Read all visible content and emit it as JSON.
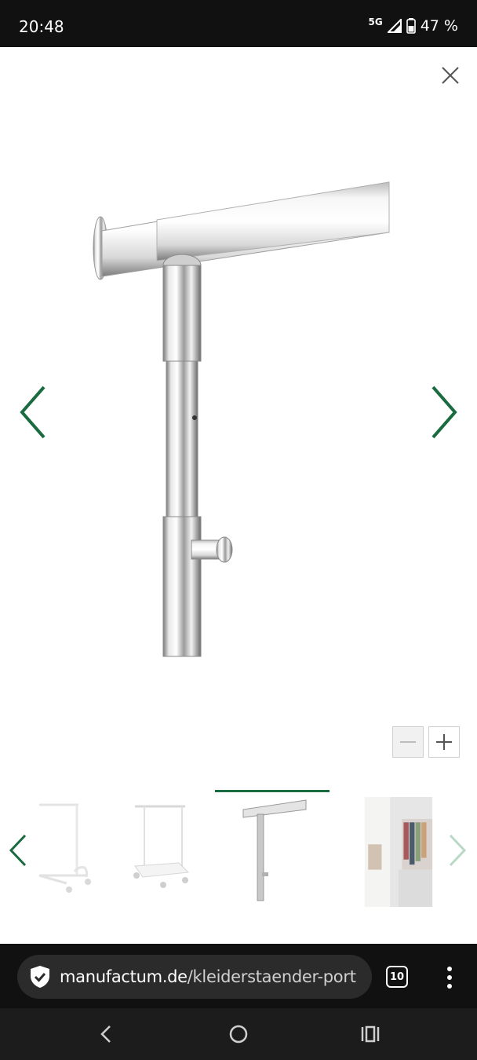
{
  "status_bar": {
    "time": "20:48",
    "network": "5G",
    "battery": "47 %"
  },
  "viewer": {
    "main_image_icon": "chrome-clothes-rail-telescopic-pole",
    "close_icon": "close-icon",
    "prev_icon": "chevron-left-icon",
    "next_icon": "chevron-right-icon",
    "accent_color": "#1a6b3f",
    "zoom": {
      "minus_icon": "minus-icon",
      "plus_icon": "plus-icon",
      "minus_enabled": false,
      "plus_enabled": true
    },
    "thumbnails": [
      {
        "icon": "white-clothes-rack-thumbnail",
        "active": false
      },
      {
        "icon": "white-clothes-rack-with-shelf-thumbnail",
        "active": false
      },
      {
        "icon": "chrome-pole-detail-thumbnail",
        "active": true
      },
      {
        "icon": "hallway-room-with-rack-thumbnail",
        "active": false
      }
    ]
  },
  "browser": {
    "url_domain": "manufactum.de",
    "url_path": "/kleiderstaender-port",
    "tab_count": "10"
  }
}
